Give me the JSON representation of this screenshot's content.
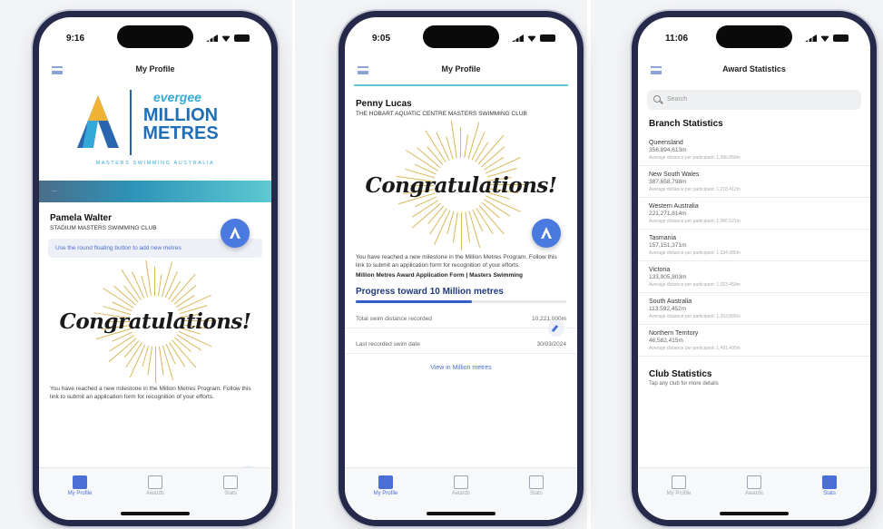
{
  "colors": {
    "accent": "#4a6fd6",
    "brand_blue": "#1f6fb8",
    "brand_light": "#34a8d8",
    "gold": "#d9b85a",
    "frame": "#262a4a"
  },
  "tabs": [
    {
      "label": "My Profile",
      "icon": "profile-icon"
    },
    {
      "label": "Awards",
      "icon": "awards-icon"
    },
    {
      "label": "Stats",
      "icon": "stats-icon"
    }
  ],
  "phone1": {
    "time": "9:16",
    "title": "My Profile",
    "logo": {
      "brand_small": "evergee",
      "brand_big_1": "MILLION",
      "brand_big_2": "METRES",
      "brand_sub": "MASTERS SWIMMING AUSTRALIA"
    },
    "banner_text": "...",
    "member_name": "Pamela Walter",
    "member_club": "STADIUM MASTERS SWIMMING CLUB",
    "info_text": "Use the round floating button to add new metres",
    "congrats": "Congratulations!",
    "milestone_text": "You have reached a new milestone in the Million Metres Program. Follow this link to submit an application form for recognition of your efforts."
  },
  "phone2": {
    "time": "9:05",
    "title": "My Profile",
    "member_name": "Penny Lucas",
    "member_club": "THE HOBART AQUATIC CENTRE MASTERS SWIMMING CLUB",
    "congrats": "Congratulations!",
    "milestone_text": "You have reached a new milestone in the Million Metres Program. Follow this link to submit an application form for recognition of your efforts.",
    "form_link": "Million Metres Award Application Form | Masters Swimming",
    "progress_title": "Progress toward 10 Million metres",
    "progress_fraction": 0.55,
    "rows": [
      {
        "label": "Total swim distance recorded",
        "value": "10,221,000m"
      },
      {
        "label": "Last recorded swim date",
        "value": "30/03/2024"
      }
    ],
    "button_text": "View in Million metres"
  },
  "phone3": {
    "time": "11:06",
    "title": "Award Statistics",
    "search_placeholder": "Search",
    "branch_heading": "Branch Statistics",
    "branches": [
      {
        "name": "Queensland",
        "value": "356,894,613m",
        "sub": "Average distance per participant: 1,306,858m"
      },
      {
        "name": "New South Wales",
        "value": "387,658,798m",
        "sub": "Average distance per participant: 1,218,412m"
      },
      {
        "name": "Western Australia",
        "value": "221,271,814m",
        "sub": "Average distance per participant: 1,066,521m"
      },
      {
        "name": "Tasmania",
        "value": "157,151,371m",
        "sub": "Average distance per participant: 1,534,980m"
      },
      {
        "name": "Victoria",
        "value": "133,905,803m",
        "sub": "Average distance per participant: 1,023,459m"
      },
      {
        "name": "South Australia",
        "value": "113,592,452m",
        "sub": "Average distance per participant: 1,203,889m"
      },
      {
        "name": "Northern Territory",
        "value": "46,582,415m",
        "sub": "Average distance per participant: 1,491,405m"
      }
    ],
    "club_heading": "Club Statistics",
    "club_sub": "Tap any club for more details"
  }
}
